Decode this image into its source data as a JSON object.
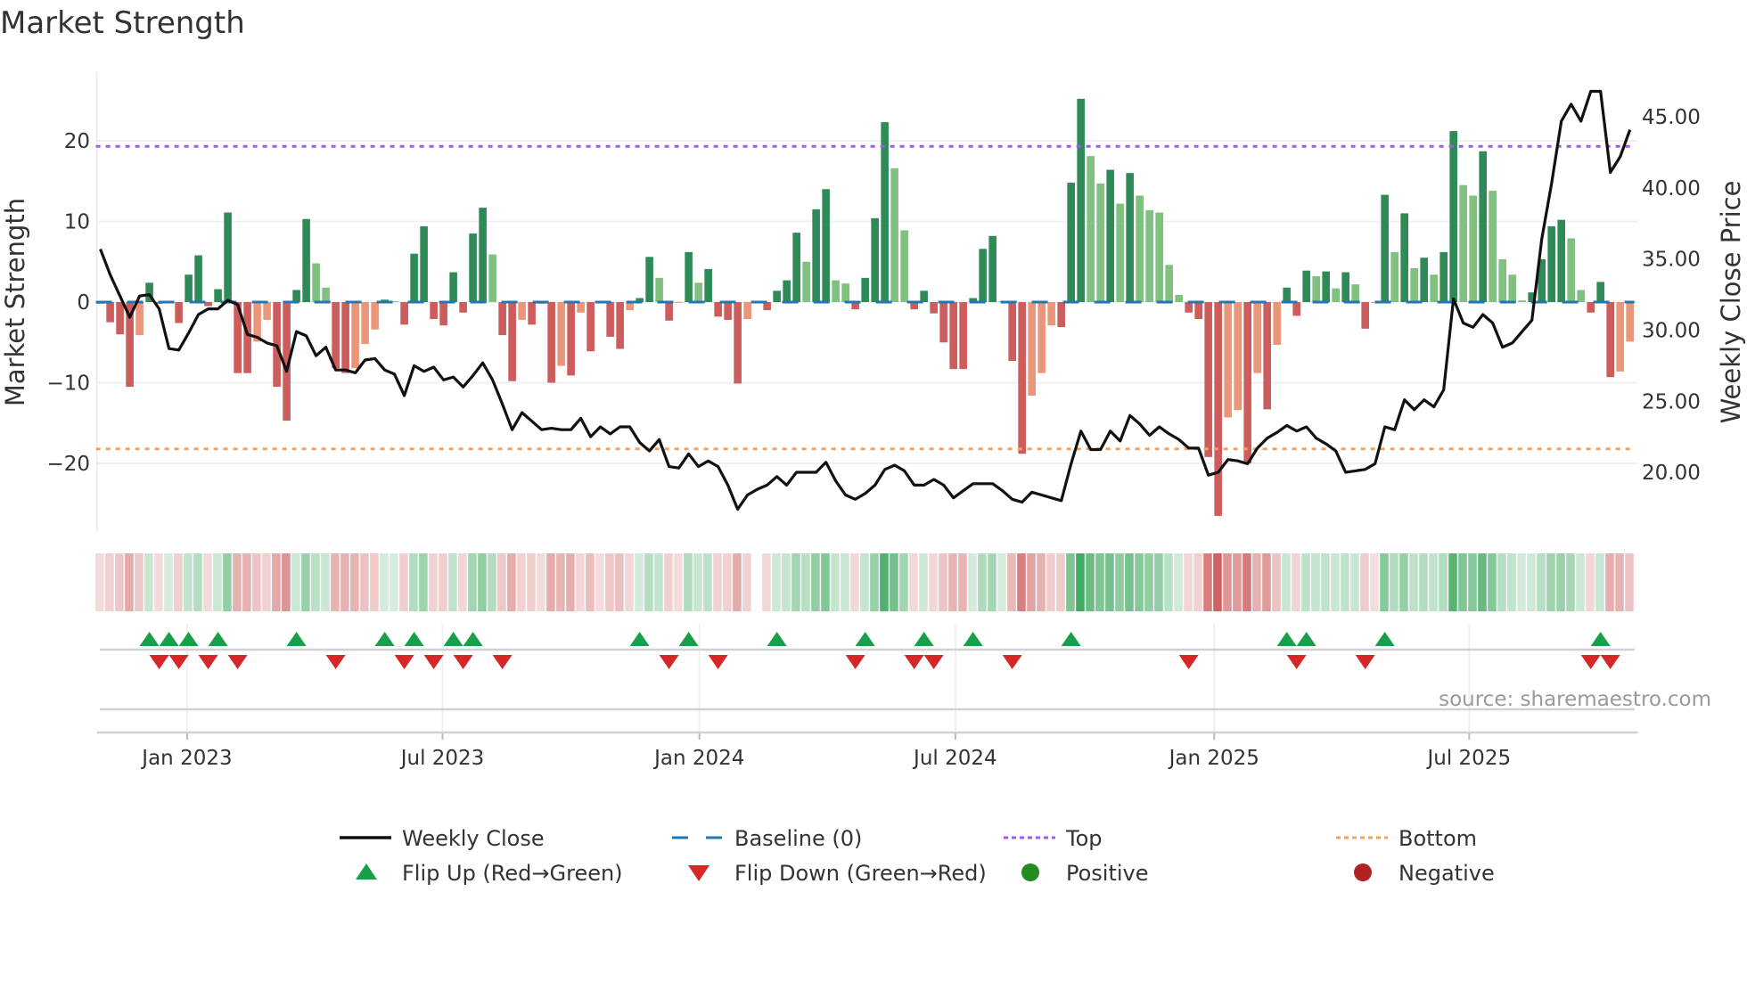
{
  "title": "Market Strength",
  "source": "source: sharemaestro.com",
  "colors": {
    "strong_pos": "#2e8b57",
    "weak_pos": "#80c080",
    "strong_neg": "#cd5c5c",
    "weak_neg": "#e9967a",
    "close": "#111111",
    "baseline": "#1f77b4",
    "top": "#9b5de5",
    "bottom": "#f4a261",
    "flip_up": "#1a9e4a",
    "flip_down": "#d62728",
    "positive": "#228b22",
    "negative": "#b22222",
    "strip_pos": "#2ea050",
    "strip_neg": "#c85050"
  },
  "chart_data": {
    "type": "bar+line",
    "title": "Market Strength",
    "x_unit": "week index",
    "xlim": [
      -0.35,
      156.8
    ],
    "x_ticks": [
      {
        "x": 8.85,
        "label": "Jan 2023"
      },
      {
        "x": 34.9,
        "label": "Jul 2023"
      },
      {
        "x": 61.1,
        "label": "Jan 2024"
      },
      {
        "x": 87.2,
        "label": "Jul 2024"
      },
      {
        "x": 113.6,
        "label": "Jan 2025"
      },
      {
        "x": 139.6,
        "label": "Jul 2025"
      }
    ],
    "ylabel": "Market Strength",
    "ylim": [
      -28.5,
      28.5
    ],
    "y_ticks": [
      {
        "v": -20,
        "label": "−20"
      },
      {
        "v": -10,
        "label": "−10"
      },
      {
        "v": 0,
        "label": "0"
      },
      {
        "v": 10,
        "label": "10"
      },
      {
        "v": 20,
        "label": "20"
      }
    ],
    "y2label": "Weekly Close Price",
    "y2lim": [
      15.8,
      48.15
    ],
    "y2_ticks": [
      {
        "v": 20,
        "label": "20.00"
      },
      {
        "v": 25,
        "label": "25.00"
      },
      {
        "v": 30,
        "label": "30.00"
      },
      {
        "v": 35,
        "label": "35.00"
      },
      {
        "v": 40,
        "label": "40.00"
      },
      {
        "v": 45,
        "label": "45.00"
      }
    ],
    "top_level": 19.3,
    "bottom_level": -18.2,
    "baseline": 0,
    "strength": [
      -0.2,
      -2.5,
      -4,
      -10.5,
      -4.1,
      2.4,
      -0.2,
      0.1,
      -2.6,
      3.4,
      5.8,
      -0.5,
      1.6,
      11.1,
      -8.8,
      -8.8,
      -4.9,
      -2.2,
      -10.5,
      -14.7,
      1.5,
      10.3,
      4.8,
      1.8,
      -8.2,
      -8.8,
      -8.2,
      -5.2,
      -3.4,
      0.3,
      0.1,
      -2.8,
      6,
      9.4,
      -2.1,
      -2.9,
      3.7,
      -1.3,
      8.5,
      11.7,
      5.9,
      -4.1,
      -9.8,
      -2.2,
      -2.8,
      -0.2,
      -10,
      -7.9,
      -9.1,
      -1.3,
      -6.1,
      -0.1,
      -4.3,
      -5.8,
      -1,
      0.5,
      5.6,
      3,
      -2.3,
      -0.1,
      6.2,
      2.4,
      4.1,
      -1.8,
      -2.2,
      -10.1,
      -2.1,
      0,
      -1,
      1.4,
      2.7,
      8.6,
      5,
      11.5,
      14,
      2.7,
      2.3,
      -0.9,
      3,
      10.4,
      22.3,
      16.6,
      8.9,
      -0.9,
      1.4,
      -1.4,
      -5,
      -8.3,
      -8.3,
      0.5,
      6.6,
      8.2,
      0.1,
      -7.3,
      -18.8,
      -11.6,
      -8.8,
      -2.9,
      -3.1,
      14.8,
      25.2,
      18.1,
      14.7,
      16.4,
      12.2,
      16,
      13.2,
      11.4,
      11.1,
      4.6,
      0.9,
      -1.3,
      -2.1,
      -19.2,
      -26.5,
      -14.3,
      -13.4,
      -20,
      -8.8,
      -13.3,
      -5.3,
      1.8,
      -1.7,
      3.9,
      3.2,
      3.8,
      1.7,
      3.7,
      2.2,
      -3.3,
      -0.1,
      13.3,
      6.2,
      11,
      4.2,
      5.5,
      3.4,
      6.2,
      21.2,
      14.5,
      13.2,
      18.7,
      13.8,
      5.3,
      3.4,
      0.2,
      1.2,
      5.3,
      9.4,
      10.2,
      7.9,
      1.5,
      -1.3,
      2.5,
      -9.3,
      -8.6,
      -4.9
    ],
    "weekly_close": [
      35.7,
      33.9,
      32.4,
      30.9,
      32.4,
      32.5,
      31.5,
      28.7,
      28.6,
      29.8,
      31.1,
      31.5,
      31.5,
      32.1,
      31.8,
      29.7,
      29.5,
      29.1,
      28.9,
      27.1,
      29.9,
      29.6,
      28.2,
      28.8,
      27.2,
      27.2,
      27.0,
      27.9,
      28.0,
      27.2,
      26.9,
      25.4,
      27.5,
      27.1,
      27.4,
      26.5,
      26.7,
      26.0,
      26.8,
      27.7,
      26.5,
      24.8,
      23.0,
      24.2,
      23.6,
      23.0,
      23.1,
      23.0,
      23.0,
      23.8,
      22.5,
      23.2,
      22.7,
      23.2,
      23.2,
      22.1,
      21.5,
      22.3,
      20.4,
      20.3,
      21.3,
      20.4,
      20.8,
      20.4,
      19.1,
      17.4,
      18.4,
      18.8,
      19.1,
      19.7,
      19.1,
      20.0,
      20.0,
      20.0,
      20.7,
      19.4,
      18.4,
      18.1,
      18.5,
      19.1,
      20.2,
      20.5,
      20.1,
      19.1,
      19.1,
      19.5,
      19.1,
      18.2,
      18.7,
      19.2,
      19.2,
      19.2,
      18.7,
      18.1,
      17.9,
      18.6,
      18.4,
      18.2,
      18.0,
      20.6,
      22.9,
      21.6,
      21.6,
      22.9,
      22.2,
      24.0,
      23.4,
      22.6,
      23.2,
      22.7,
      22.3,
      21.7,
      21.7,
      19.8,
      20.0,
      20.9,
      20.8,
      20.6,
      21.7,
      22.4,
      22.8,
      23.3,
      22.9,
      23.2,
      22.4,
      22.0,
      21.5,
      20.0,
      20.1,
      20.2,
      20.6,
      23.2,
      23.0,
      25.1,
      24.4,
      25.1,
      24.6,
      25.8,
      32.2,
      30.5,
      30.2,
      31.1,
      30.5,
      28.8,
      29.1,
      29.9,
      30.7,
      36.4,
      40.3,
      44.7,
      45.9,
      44.7,
      46.8,
      46.8,
      41.1,
      42.2,
      44.1
    ],
    "flip_up": [
      5,
      7,
      9,
      12,
      20,
      29,
      32,
      36,
      38,
      55,
      60,
      69,
      78,
      84,
      89,
      99,
      121,
      123,
      131,
      153
    ],
    "flip_down": [
      6,
      8,
      11,
      14,
      24,
      31,
      34,
      37,
      41,
      58,
      63,
      77,
      83,
      85,
      93,
      111,
      122,
      129,
      152,
      154
    ],
    "legend": [
      {
        "label": "Weekly Close",
        "kind": "line"
      },
      {
        "label": "Baseline (0)",
        "kind": "dash"
      },
      {
        "label": "Top",
        "kind": "dot-top"
      },
      {
        "label": "Bottom",
        "kind": "dot-bottom"
      },
      {
        "label": "Flip Up (Red→Green)",
        "kind": "tri-up"
      },
      {
        "label": "Flip Down (Green→Red)",
        "kind": "tri-down"
      },
      {
        "label": "Positive",
        "kind": "circle-pos"
      },
      {
        "label": "Negative",
        "kind": "circle-neg"
      }
    ],
    "legend_position": "bottom-center"
  }
}
